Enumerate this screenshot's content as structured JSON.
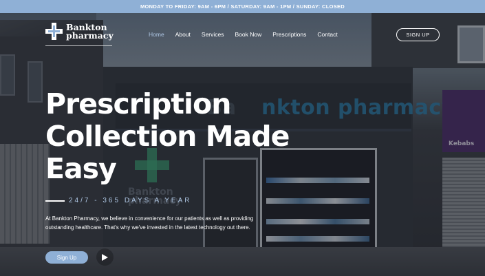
{
  "topbar": {
    "hours": "MONDAY TO FRIDAY: 9AM - 6PM / SATURDAY: 9AM - 1PM / SUNDAY: CLOSED"
  },
  "brand": {
    "line1": "Bankton",
    "line2": "pharmacy"
  },
  "nav": {
    "items": [
      {
        "label": "Home",
        "active": true
      },
      {
        "label": "About"
      },
      {
        "label": "Services"
      },
      {
        "label": "Book Now"
      },
      {
        "label": "Prescriptions"
      },
      {
        "label": "Contact"
      }
    ]
  },
  "header": {
    "signup_label": "SIGN UP"
  },
  "hero": {
    "headline": "Prescription Collection Made Easy",
    "tagline": "24/7 - 365 DAYS A YEAR",
    "intro": "At Bankton Pharmacy, we believe in convenience for our patients as well as providing outstanding healthcare. That's why we've invested in the latest technology out there.",
    "signup_label": "Sign Up",
    "play_icon": "play-icon"
  },
  "photo": {
    "shop_sign": "nkton pharmacy",
    "shop_sign_left": "Ba",
    "shop_logo": "Bankton pharmacy",
    "neighbour_sign": "Kebabs"
  },
  "colors": {
    "accent": "#8fb0d6",
    "accent_text": "#aec6e3",
    "white": "#ffffff"
  }
}
